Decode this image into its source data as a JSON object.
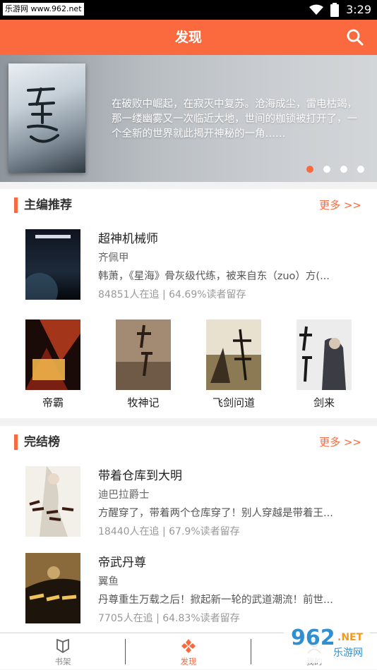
{
  "status_bar": {
    "watermark": "乐游网 www.962.net",
    "time": "3:29"
  },
  "header": {
    "title": "发现",
    "search_icon": "search-icon"
  },
  "banner": {
    "description": "在破败中崛起，在寂灭中复苏。沧海成尘，雷电枯竭，那一缕幽雾又一次临近大地，世间的枷锁被打开了，一个全新的世界就此揭开神秘的一角……",
    "cover_title": "圣墟",
    "dots": 4,
    "active_dot": 0
  },
  "editor_pick": {
    "title": "主编推荐",
    "more": "更多 >>",
    "featured": {
      "title": "超神机械师",
      "author": "齐佩甲",
      "intro": "韩萧，《星海》骨灰级代练，被来自东（zuo）方(...",
      "stat": "84851人在追 | 64.69%读者留存"
    },
    "grid": [
      {
        "title": "帝霸"
      },
      {
        "title": "牧神记"
      },
      {
        "title": "飞剑问道"
      },
      {
        "title": "剑来"
      }
    ]
  },
  "finished": {
    "title": "完结榜",
    "more": "更多 >>",
    "books": [
      {
        "title": "带着仓库到大明",
        "author": "迪巴拉爵士",
        "intro": "方醒穿了，带着两个仓库穿了！别人穿越是带着王...",
        "stat": "18440人在追 | 67.9%读者留存"
      },
      {
        "title": "帝武丹尊",
        "author": "翼鱼",
        "intro": "丹尊重生万载之后！掀起新一轮的武道潮流！前世...",
        "stat": "7705人在追 | 64.83%读者留存"
      }
    ]
  },
  "tabbar": [
    {
      "label": "书架",
      "icon": "bookmark-shield-icon"
    },
    {
      "label": "发现",
      "icon": "discover-grid-icon"
    },
    {
      "label": "我的",
      "icon": "user-icon"
    }
  ],
  "colors": {
    "accent": "#fa6a3e",
    "header_bg": "#fa6a3e",
    "muted": "#999999"
  }
}
